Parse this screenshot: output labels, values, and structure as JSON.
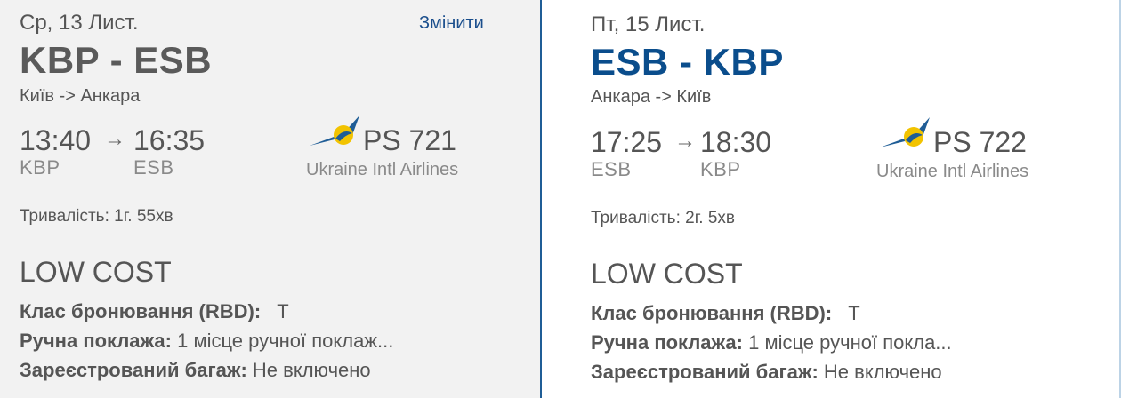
{
  "outbound": {
    "date": "Ср, 13 Лист.",
    "change_label": "Змінити",
    "route": "KBP - ESB",
    "cities": "Київ -> Анкара",
    "depart_time": "13:40",
    "arrow": "→",
    "arrive_time": "16:35",
    "depart_code": "KBP",
    "arrive_code": "ESB",
    "flight_number": "PS 721",
    "airline": "Ukraine Intl Airlines",
    "duration": "Тривалість: 1г. 55хв",
    "fare": "LOW COST",
    "rbd_label": "Клас бронювання (RBD):",
    "rbd_value": "Т",
    "hand_label": "Ручна поклажа:",
    "hand_value": "1 місце ручної поклаж...",
    "bag_label": "Зареєстрований багаж:",
    "bag_value": "Не включено"
  },
  "inbound": {
    "date": "Пт, 15 Лист.",
    "route": "ESB - KBP",
    "cities": "Анкара -> Київ",
    "depart_time": "17:25",
    "arrow": "→",
    "arrive_time": "18:30",
    "depart_code": "ESB",
    "arrive_code": "KBP",
    "flight_number": "PS 722",
    "airline": "Ukraine Intl Airlines",
    "duration": "Тривалість: 2г. 5хв",
    "fare": "LOW COST",
    "rbd_label": "Клас бронювання (RBD):",
    "rbd_value": "Т",
    "hand_label": "Ручна поклажа:",
    "hand_value": "1 місце ручної покла...",
    "bag_label": "Зареєстрований багаж:",
    "bag_value": "Не включено"
  },
  "colors": {
    "route_outbound": "#5a5a5a",
    "route_inbound": "#0a4d8c",
    "logo_blue": "#1f5d96",
    "logo_yellow": "#f2c300",
    "link": "#1a4e8c"
  },
  "icons": {
    "airline_logo": "uia-airplane-logo-icon"
  }
}
